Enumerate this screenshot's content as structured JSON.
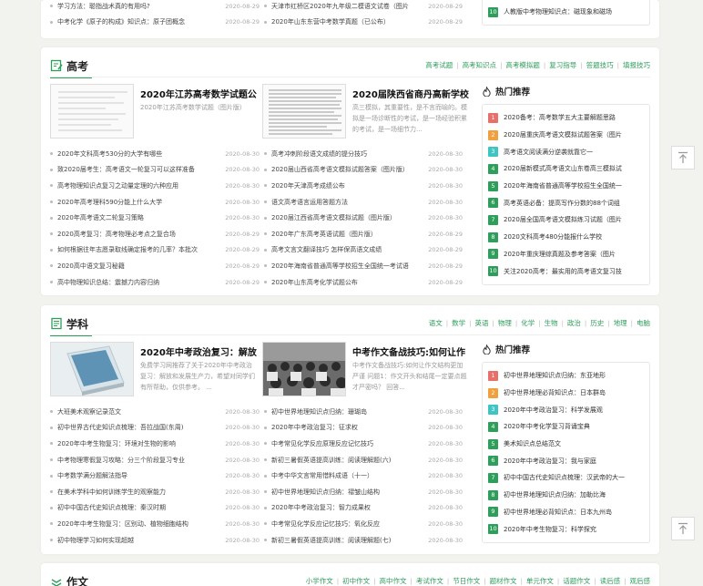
{
  "top": {
    "rows": [
      {
        "left": "学习方法：聪指战术真的有用吗?",
        "left_date": "2020-08-29",
        "mid": "天津市红桥区2020年九年级二模语文试卷（图片",
        "mid_date": "2020-08-29"
      },
      {
        "left": "中考化学《原子的构成》知识点：原子团概念",
        "left_date": "2020-08-29",
        "mid": "2020年山东东营中考数学真题（已公布）",
        "mid_date": "2020-08-29"
      }
    ],
    "hot_item": {
      "num": "10",
      "text": "人教版中考物理知识点：磁现象和磁场"
    }
  },
  "gaokao": {
    "title": "高考",
    "nav": [
      "高考试题",
      "高考知识点",
      "高考模拟题",
      "复习指导",
      "答题技巧",
      "填报技巧"
    ],
    "features": [
      {
        "title": "2020年江苏高考数学试题公",
        "desc": "2020年江苏高考数学试题（图片版）"
      },
      {
        "title": "2020届陕西省商丹高新学校",
        "desc": "高三模拟，其重要性，是不言而喻的。模拟是一场诊断性的考试，是一场经验积累的考试，是一场细节力..."
      }
    ],
    "list_left": [
      {
        "t": "2020年文科高考530分的大学有哪些",
        "d": "2020-08-30"
      },
      {
        "t": "致2020届考生：高考语文一轮复习可以这样准备",
        "d": "2020-08-30"
      },
      {
        "t": "高考物理知识点复习之动量定理的六种应用",
        "d": "2020-08-30"
      },
      {
        "t": "2020年高考理科590分能上什么大学",
        "d": "2020-08-30"
      },
      {
        "t": "2020年高考语文二轮复习策略",
        "d": "2020-08-30"
      },
      {
        "t": "2020高考复习：高考物理必考点之复合场",
        "d": "2020-08-29"
      },
      {
        "t": "如何根据往年志愿录取线确定报考的几率？本批次",
        "d": "2020-08-29"
      },
      {
        "t": "2020高中语文复习秘籍",
        "d": "2020-08-29"
      },
      {
        "t": "高中物理知识总结：震撼力内容归纳",
        "d": "2020-08-29"
      }
    ],
    "list_mid": [
      {
        "t": "高考冲刺阶段语文成绩的提分技巧",
        "d": "2020-08-30"
      },
      {
        "t": "2020届山西省高考语文模拟试题答案（图片版）",
        "d": "2020-08-30"
      },
      {
        "t": "2020年天津高考成绩公布",
        "d": "2020-08-30"
      },
      {
        "t": "语文高考语言运用答题方法",
        "d": "2020-08-30"
      },
      {
        "t": "2020届江西省高考语文模拟试题（图片版）",
        "d": "2020-08-30"
      },
      {
        "t": "2020年广东高考英语试题（图片版）",
        "d": "2020-08-29"
      },
      {
        "t": "高考文言文翻译技巧 怎样保高语文成绩",
        "d": "2020-08-29"
      },
      {
        "t": "2020年海南省普通高等学校招生全国统一考试语",
        "d": "2020-08-29"
      },
      {
        "t": "2020年山东高考化学试题公布",
        "d": "2020-08-29"
      }
    ],
    "hot_title": "热门推荐",
    "hot": [
      {
        "n": "1",
        "t": "2020备考：高考数学五大主要解题思路"
      },
      {
        "n": "2",
        "t": "2020届重庆高考语文模拟试题答案（图片"
      },
      {
        "n": "3",
        "t": "高考语文阅读满分逆袭就靠它一"
      },
      {
        "n": "4",
        "t": "2020届新模式高考语文山东卷高三模拟试"
      },
      {
        "n": "5",
        "t": "2020年海南省普通高等学校招生全国统一"
      },
      {
        "n": "6",
        "t": "高考英语必备：提高写作分数的88个词组"
      },
      {
        "n": "7",
        "t": "2020届全国高考语文模拟练习试题（图片"
      },
      {
        "n": "8",
        "t": "2020文科高考480分能报什么学校"
      },
      {
        "n": "9",
        "t": "2020年重庆理综真题及参考答案（图片"
      },
      {
        "n": "10",
        "t": "关注2020高考：最实用的高考语文复习技"
      }
    ]
  },
  "xueke": {
    "title": "学科",
    "nav": [
      "语文",
      "数学",
      "英语",
      "物理",
      "化学",
      "生物",
      "政治",
      "历史",
      "地理",
      "电脑"
    ],
    "features": [
      {
        "title": "2020年中考政治复习：解放",
        "desc": "免费学习网推荐了关于2020年中考政治复习：解放和发展生产力，希望对同学们有所帮助，仅供参考。 ..."
      },
      {
        "title": "中考作文备战技巧:如何让作",
        "desc": "中考作文备战技巧:如何让作文结构更加严谨 问题1：作文开头和结尾一定要点题才严密吗？ 回答..."
      }
    ],
    "list_left": [
      {
        "t": "大班美术观察记录范文",
        "d": "2020-08-30"
      },
      {
        "t": "初中世界古代史知识点梳理：吾拉战国(东周)",
        "d": "2020-08-30"
      },
      {
        "t": "2020年中考生物复习：环境对生物的影响",
        "d": "2020-08-30"
      },
      {
        "t": "中考物理寒假复习攻略：分三个阶段复习专业",
        "d": "2020-08-30"
      },
      {
        "t": "中考数学满分题解法指导",
        "d": "2020-08-30"
      },
      {
        "t": "在美术学科中如何训练学生的观察能力",
        "d": "2020-08-30"
      },
      {
        "t": "初中中国古代史知识点梳理：秦汉时期",
        "d": "2020-08-30"
      },
      {
        "t": "2020年中考生物复习：区别动、植物细胞结构",
        "d": "2020-08-30"
      },
      {
        "t": "初中物理学习如何实现超越",
        "d": "2020-08-30"
      }
    ],
    "list_mid": [
      {
        "t": "初中世界地理知识点归纳：珊瑚岛",
        "d": "2020-08-30"
      },
      {
        "t": "2020年中考政治复习：征求权",
        "d": "2020-08-30"
      },
      {
        "t": "中考常见化学反应原理反应记忆技巧",
        "d": "2020-08-30"
      },
      {
        "t": "新初三暑假英语提高训练：阅读理解题(六)",
        "d": "2020-08-30"
      },
      {
        "t": "中考中华文言常用惜料成语（十一）",
        "d": "2020-08-30"
      },
      {
        "t": "初中世界地理知识点归纳：褶皱山结构",
        "d": "2020-08-30"
      },
      {
        "t": "2020年中考政治复习：智力成果权",
        "d": "2020-08-30"
      },
      {
        "t": "中考常见化学反应记忆技巧：氧化反应",
        "d": "2020-08-30"
      },
      {
        "t": "新初三暑假英语提高训练：阅读理解题(七)",
        "d": "2020-08-30"
      }
    ],
    "hot_title": "热门推荐",
    "hot": [
      {
        "n": "1",
        "t": "初中世界地理知识点归纳：东亚地形"
      },
      {
        "n": "2",
        "t": "初中世界地理必背知识点：日本群岛"
      },
      {
        "n": "3",
        "t": "2020年中考政治复习：科学发展观"
      },
      {
        "n": "4",
        "t": "2020年中考化学复习背诵宝典"
      },
      {
        "n": "5",
        "t": "美术知识点总结范文"
      },
      {
        "n": "6",
        "t": "2020年中考政治复习：我与家庭"
      },
      {
        "n": "7",
        "t": "初中中国古代史知识点梳理：汉武帝的大一"
      },
      {
        "n": "8",
        "t": "初中世界地理知识点归纳：加勒比海"
      },
      {
        "n": "9",
        "t": "初中世界地理必背知识点：日本九州岛"
      },
      {
        "n": "10",
        "t": "2020年中考生物复习：科学探究"
      }
    ]
  },
  "zuowen": {
    "title": "作文",
    "nav": [
      "小学作文",
      "初中作文",
      "高中作文",
      "考试作文",
      "节日作文",
      "题材作文",
      "单元作文",
      "话题作文",
      "读后感",
      "观后感"
    ]
  },
  "colors": {
    "accent": "#2e9e5b",
    "rank1": "#e96f6a",
    "rank2": "#f0a03c",
    "rank3": "#3fc4c4"
  },
  "icons": {
    "gaokao": "book-edit-icon",
    "xueke": "document-icon",
    "zuowen": "chevron-stack-icon",
    "hot": "fire-icon",
    "back": "back-to-top-icon"
  }
}
